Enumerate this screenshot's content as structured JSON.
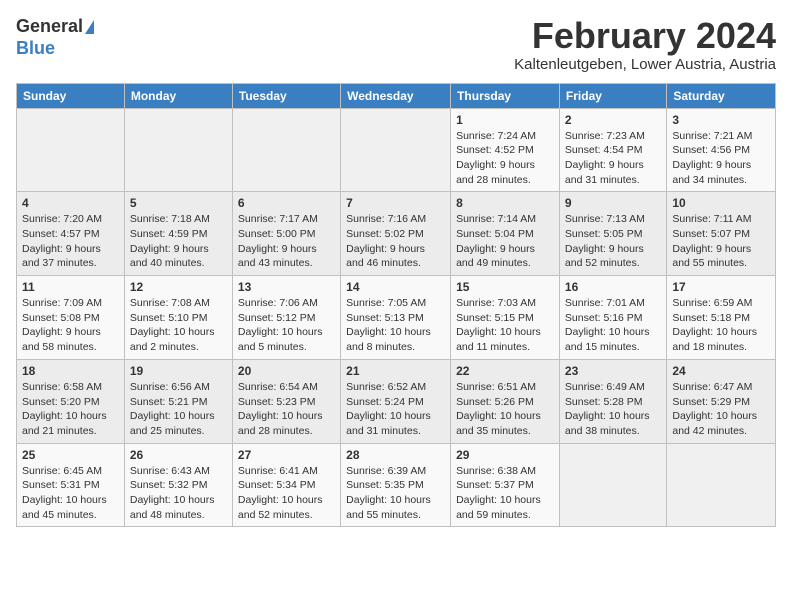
{
  "header": {
    "logo_general": "General",
    "logo_blue": "Blue",
    "title": "February 2024",
    "subtitle": "Kaltenleutgeben, Lower Austria, Austria"
  },
  "calendar": {
    "days_of_week": [
      "Sunday",
      "Monday",
      "Tuesday",
      "Wednesday",
      "Thursday",
      "Friday",
      "Saturday"
    ],
    "weeks": [
      [
        {
          "day": "",
          "detail": ""
        },
        {
          "day": "",
          "detail": ""
        },
        {
          "day": "",
          "detail": ""
        },
        {
          "day": "",
          "detail": ""
        },
        {
          "day": "1",
          "detail": "Sunrise: 7:24 AM\nSunset: 4:52 PM\nDaylight: 9 hours\nand 28 minutes."
        },
        {
          "day": "2",
          "detail": "Sunrise: 7:23 AM\nSunset: 4:54 PM\nDaylight: 9 hours\nand 31 minutes."
        },
        {
          "day": "3",
          "detail": "Sunrise: 7:21 AM\nSunset: 4:56 PM\nDaylight: 9 hours\nand 34 minutes."
        }
      ],
      [
        {
          "day": "4",
          "detail": "Sunrise: 7:20 AM\nSunset: 4:57 PM\nDaylight: 9 hours\nand 37 minutes."
        },
        {
          "day": "5",
          "detail": "Sunrise: 7:18 AM\nSunset: 4:59 PM\nDaylight: 9 hours\nand 40 minutes."
        },
        {
          "day": "6",
          "detail": "Sunrise: 7:17 AM\nSunset: 5:00 PM\nDaylight: 9 hours\nand 43 minutes."
        },
        {
          "day": "7",
          "detail": "Sunrise: 7:16 AM\nSunset: 5:02 PM\nDaylight: 9 hours\nand 46 minutes."
        },
        {
          "day": "8",
          "detail": "Sunrise: 7:14 AM\nSunset: 5:04 PM\nDaylight: 9 hours\nand 49 minutes."
        },
        {
          "day": "9",
          "detail": "Sunrise: 7:13 AM\nSunset: 5:05 PM\nDaylight: 9 hours\nand 52 minutes."
        },
        {
          "day": "10",
          "detail": "Sunrise: 7:11 AM\nSunset: 5:07 PM\nDaylight: 9 hours\nand 55 minutes."
        }
      ],
      [
        {
          "day": "11",
          "detail": "Sunrise: 7:09 AM\nSunset: 5:08 PM\nDaylight: 9 hours\nand 58 minutes."
        },
        {
          "day": "12",
          "detail": "Sunrise: 7:08 AM\nSunset: 5:10 PM\nDaylight: 10 hours\nand 2 minutes."
        },
        {
          "day": "13",
          "detail": "Sunrise: 7:06 AM\nSunset: 5:12 PM\nDaylight: 10 hours\nand 5 minutes."
        },
        {
          "day": "14",
          "detail": "Sunrise: 7:05 AM\nSunset: 5:13 PM\nDaylight: 10 hours\nand 8 minutes."
        },
        {
          "day": "15",
          "detail": "Sunrise: 7:03 AM\nSunset: 5:15 PM\nDaylight: 10 hours\nand 11 minutes."
        },
        {
          "day": "16",
          "detail": "Sunrise: 7:01 AM\nSunset: 5:16 PM\nDaylight: 10 hours\nand 15 minutes."
        },
        {
          "day": "17",
          "detail": "Sunrise: 6:59 AM\nSunset: 5:18 PM\nDaylight: 10 hours\nand 18 minutes."
        }
      ],
      [
        {
          "day": "18",
          "detail": "Sunrise: 6:58 AM\nSunset: 5:20 PM\nDaylight: 10 hours\nand 21 minutes."
        },
        {
          "day": "19",
          "detail": "Sunrise: 6:56 AM\nSunset: 5:21 PM\nDaylight: 10 hours\nand 25 minutes."
        },
        {
          "day": "20",
          "detail": "Sunrise: 6:54 AM\nSunset: 5:23 PM\nDaylight: 10 hours\nand 28 minutes."
        },
        {
          "day": "21",
          "detail": "Sunrise: 6:52 AM\nSunset: 5:24 PM\nDaylight: 10 hours\nand 31 minutes."
        },
        {
          "day": "22",
          "detail": "Sunrise: 6:51 AM\nSunset: 5:26 PM\nDaylight: 10 hours\nand 35 minutes."
        },
        {
          "day": "23",
          "detail": "Sunrise: 6:49 AM\nSunset: 5:28 PM\nDaylight: 10 hours\nand 38 minutes."
        },
        {
          "day": "24",
          "detail": "Sunrise: 6:47 AM\nSunset: 5:29 PM\nDaylight: 10 hours\nand 42 minutes."
        }
      ],
      [
        {
          "day": "25",
          "detail": "Sunrise: 6:45 AM\nSunset: 5:31 PM\nDaylight: 10 hours\nand 45 minutes."
        },
        {
          "day": "26",
          "detail": "Sunrise: 6:43 AM\nSunset: 5:32 PM\nDaylight: 10 hours\nand 48 minutes."
        },
        {
          "day": "27",
          "detail": "Sunrise: 6:41 AM\nSunset: 5:34 PM\nDaylight: 10 hours\nand 52 minutes."
        },
        {
          "day": "28",
          "detail": "Sunrise: 6:39 AM\nSunset: 5:35 PM\nDaylight: 10 hours\nand 55 minutes."
        },
        {
          "day": "29",
          "detail": "Sunrise: 6:38 AM\nSunset: 5:37 PM\nDaylight: 10 hours\nand 59 minutes."
        },
        {
          "day": "",
          "detail": ""
        },
        {
          "day": "",
          "detail": ""
        }
      ]
    ]
  }
}
